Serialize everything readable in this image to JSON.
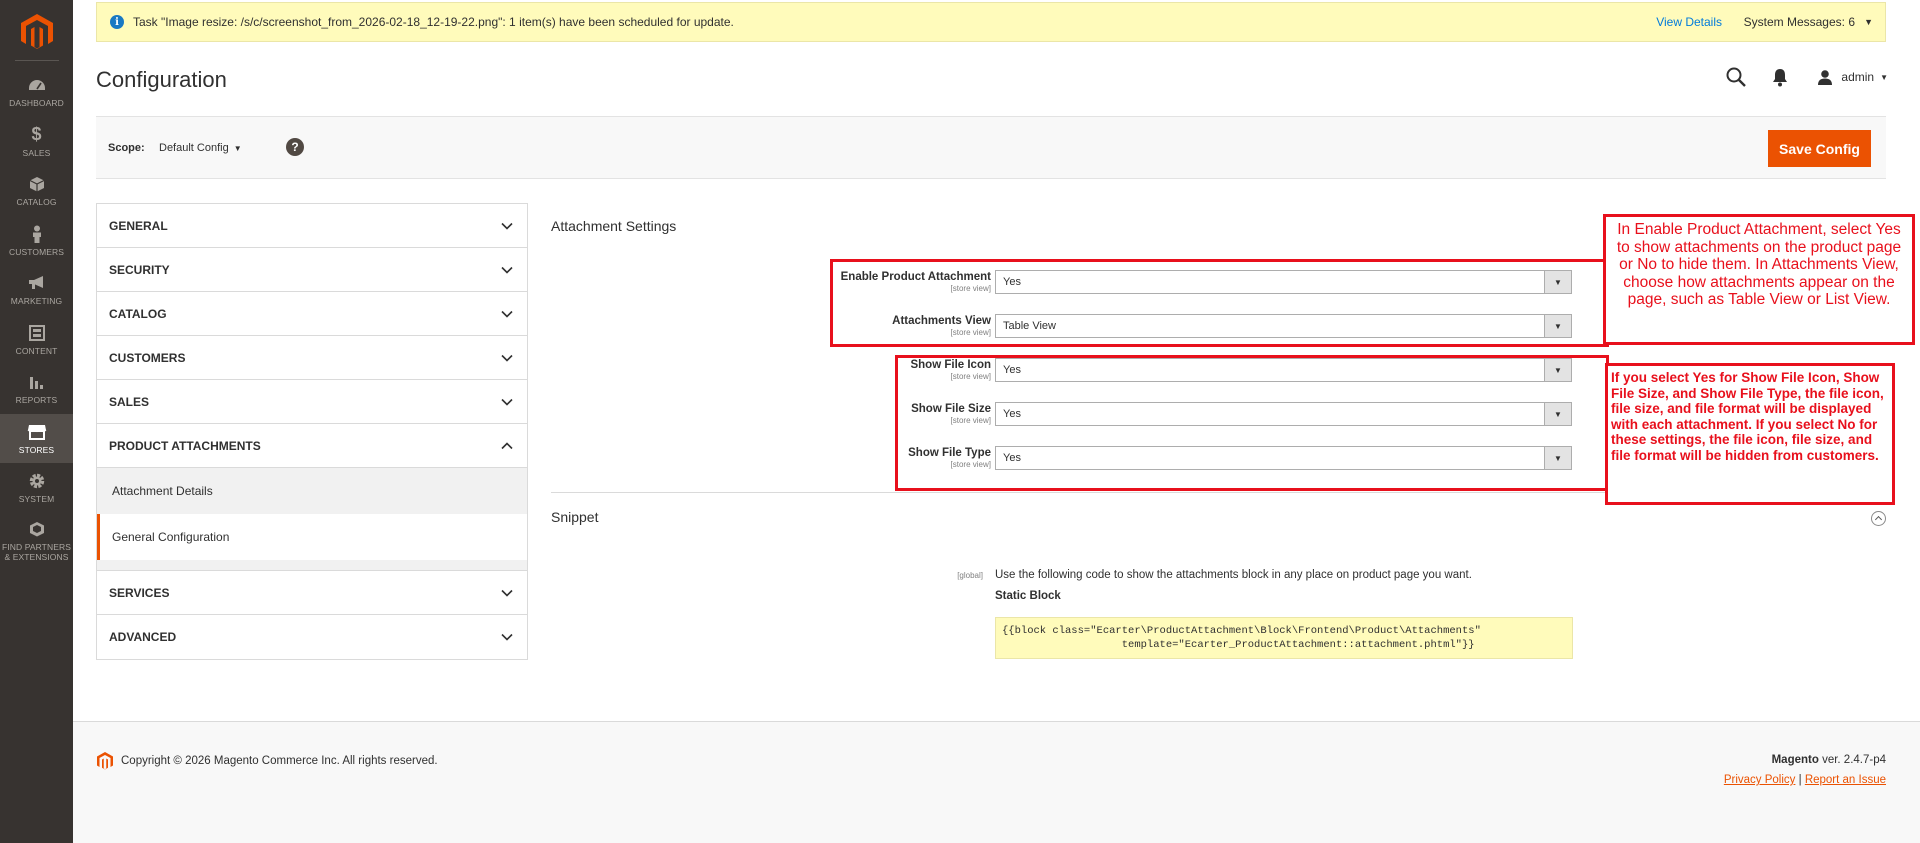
{
  "nav": {
    "items": [
      {
        "label": "Dashboard",
        "icon": "dashboard-icon"
      },
      {
        "label": "Sales",
        "icon": "dollar-icon"
      },
      {
        "label": "Catalog",
        "icon": "box-icon"
      },
      {
        "label": "Customers",
        "icon": "person-icon"
      },
      {
        "label": "Marketing",
        "icon": "megaphone-icon"
      },
      {
        "label": "Content",
        "icon": "content-icon"
      },
      {
        "label": "Reports",
        "icon": "bar-chart-icon"
      },
      {
        "label": "Stores",
        "icon": "store-icon"
      },
      {
        "label": "System",
        "icon": "gear-icon"
      },
      {
        "label": "Find Partners & Extensions",
        "icon": "extensions-icon"
      }
    ],
    "active": "Stores"
  },
  "system_message": {
    "text": "Task \"Image resize: /s/c/screenshot_from_2026-02-18_12-19-22.png\": 1 item(s) have been scheduled for update.",
    "view_details": "View Details",
    "system_messages": "System Messages: 6"
  },
  "header": {
    "title": "Configuration",
    "user": "admin"
  },
  "scope": {
    "label": "Scope:",
    "value": "Default Config",
    "save_label": "Save Config"
  },
  "tabs": {
    "items": [
      {
        "label": "GENERAL"
      },
      {
        "label": "SECURITY"
      },
      {
        "label": "CATALOG"
      },
      {
        "label": "CUSTOMERS"
      },
      {
        "label": "SALES"
      },
      {
        "label": "PRODUCT ATTACHMENTS"
      },
      {
        "label": "SERVICES"
      },
      {
        "label": "ADVANCED"
      }
    ],
    "sub_items": [
      {
        "label": "Attachment Details"
      },
      {
        "label": "General Configuration"
      }
    ]
  },
  "attachment_settings": {
    "title": "Attachment Settings",
    "fields": [
      {
        "label": "Enable Product Attachment",
        "scope": "[store view]",
        "value": "Yes"
      },
      {
        "label": "Attachments View",
        "scope": "[store view]",
        "value": "Table View"
      },
      {
        "label": "Show File Icon",
        "scope": "[store view]",
        "value": "Yes"
      },
      {
        "label": "Show File Size",
        "scope": "[store view]",
        "value": "Yes"
      },
      {
        "label": "Show File Type",
        "scope": "[store view]",
        "value": "Yes"
      }
    ]
  },
  "snippet": {
    "title": "Snippet",
    "scope": "[global]",
    "description": "Use the following code to show the attachments block in any place on product page you want.",
    "heading": "Static Block",
    "code": "{{block class=\"Ecarter\\ProductAttachment\\Block\\Frontend\\Product\\Attachments\"\n                   template=\"Ecarter_ProductAttachment::attachment.phtml\"}}"
  },
  "annotations": {
    "callout1": "In Enable Product Attachment, select Yes to show attachments on the product page or No to hide them. In Attachments View, choose how attachments appear on the page, such as Table View or List View.",
    "callout2": "If you select Yes for Show File Icon, Show File Size, and Show File Type, the file icon, file size, and file format will be displayed with each attachment. If you select No for these settings, the file icon, file size, and file format will be hidden from customers.",
    "color": "#e8101c"
  },
  "footer": {
    "copyright": "Copyright © 2026 Magento Commerce Inc. All rights reserved.",
    "brand": "Magento",
    "version": " ver. 2.4.7-p4",
    "privacy": "Privacy Policy",
    "separator": "|",
    "report": "Report an Issue"
  },
  "colors": {
    "accent": "#eb5202",
    "nav_bg": "#373330",
    "message_bg": "#fffbbb",
    "link": "#007bdb"
  }
}
